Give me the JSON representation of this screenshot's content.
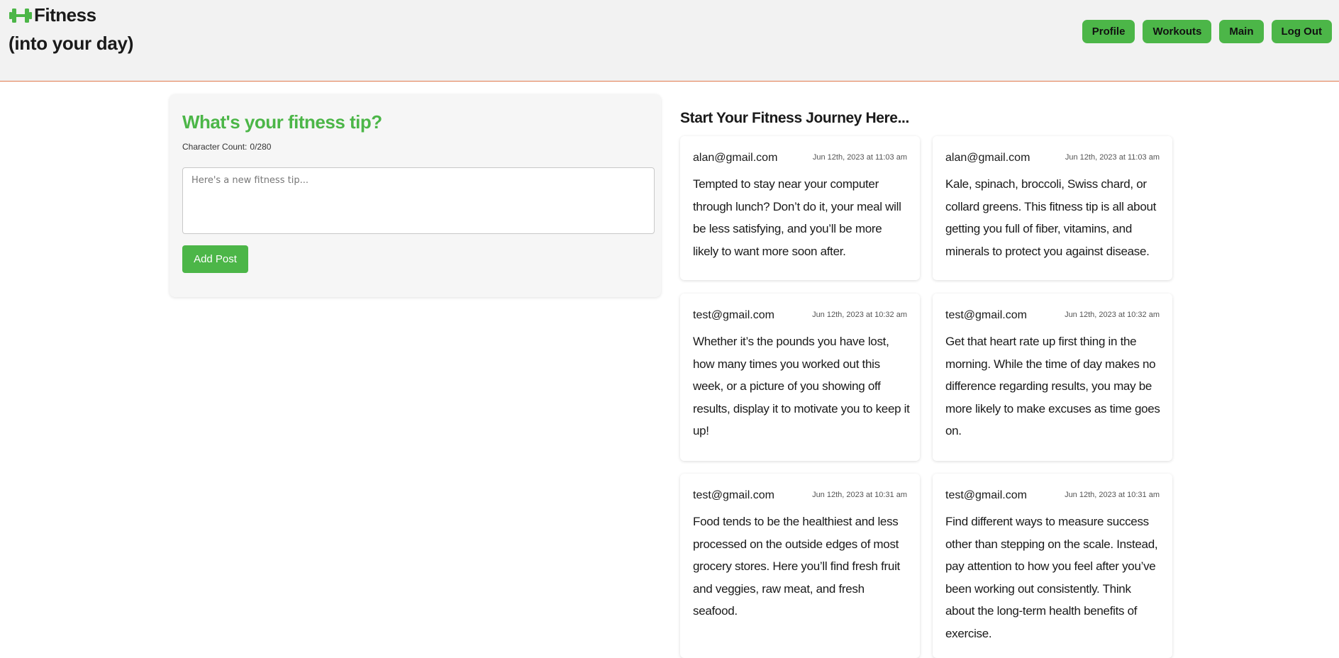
{
  "header": {
    "logo_icon": "dumbbell-icon",
    "brand": "Fitness",
    "tagline": "(into your day)",
    "nav": [
      "Profile",
      "Workouts",
      "Main",
      "Log Out"
    ]
  },
  "composer": {
    "title": "What's your fitness tip?",
    "char_count_label": "Character Count:",
    "char_count_value": "0/280",
    "placeholder": "Here's a new fitness tip...",
    "value": "",
    "submit_label": "Add Post"
  },
  "feed": {
    "title": "Start Your Fitness Journey Here...",
    "posts": [
      {
        "author": "alan@gmail.com",
        "time": "Jun 12th, 2023 at 11:03 am",
        "text": "Tempted to stay near your computer through lunch? Don’t do it, your meal will be less satisfying, and you’ll be more likely to want more soon after."
      },
      {
        "author": "alan@gmail.com",
        "time": "Jun 12th, 2023 at 11:03 am",
        "text": "Kale, spinach, broccoli, Swiss chard, or collard greens. This fitness tip is all about getting you full of fiber, vitamins, and minerals to protect you against disease."
      },
      {
        "author": "test@gmail.com",
        "time": "Jun 12th, 2023 at 10:32 am",
        "text": "Whether it’s the pounds you have lost, how many times you worked out this week, or a picture of you showing off results, display it to motivate you to keep it up!"
      },
      {
        "author": "test@gmail.com",
        "time": "Jun 12th, 2023 at 10:32 am",
        "text": "Get that heart rate up first thing in the morning. While the time of day makes no difference regarding results, you may be more likely to make excuses as time goes on."
      },
      {
        "author": "test@gmail.com",
        "time": "Jun 12th, 2023 at 10:31 am",
        "text": "Food tends to be the healthiest and less processed on the outside edges of most grocery stores. Here you’ll find fresh fruit and veggies, raw meat, and fresh seafood."
      },
      {
        "author": "test@gmail.com",
        "time": "Jun 12th, 2023 at 10:31 am",
        "text": "Find different ways to measure success other than stepping on the scale. Instead, pay attention to how you feel after you’ve been working out consistently. Think about the long-term health benefits of exercise."
      }
    ]
  },
  "colors": {
    "accent": "#4cb648",
    "header_border": "#e07a4f",
    "header_bg": "#f2f2f2"
  }
}
